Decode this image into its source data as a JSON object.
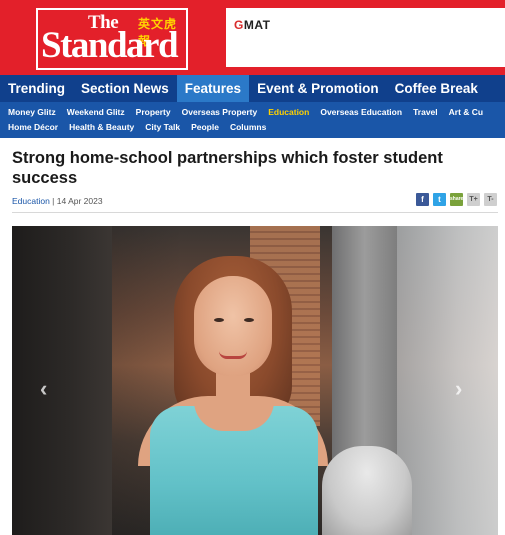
{
  "brand": {
    "logo_the": "The",
    "logo_chinese": "英文虎報",
    "logo_name": "Standard",
    "accent_red": "#e3202a",
    "nav_blue": "#10408c"
  },
  "ad": {
    "brand_g": "G",
    "brand_rest": "MAT"
  },
  "primary_nav": {
    "items": [
      "Trending",
      "Section News",
      "Features",
      "Event & Promotion",
      "Coffee Break"
    ],
    "active": "Features"
  },
  "secondary_nav": {
    "row1": [
      "Money Glitz",
      "Weekend Glitz",
      "Property",
      "Overseas Property",
      "Education",
      "Overseas Education",
      "Travel",
      "Art & Cu"
    ],
    "row2": [
      "Home Décor",
      "Health & Beauty",
      "City Talk",
      "People",
      "Columns"
    ],
    "active": "Education"
  },
  "article": {
    "headline": "Strong home-school partnerships which foster student success",
    "category": "Education",
    "separator": " | ",
    "date": "14 Apr 2023"
  },
  "share": {
    "facebook": "f",
    "twitter": "t",
    "other": "share",
    "text_plus": "T+",
    "text_minus": "T-"
  },
  "carousel": {
    "prev_icon": "‹",
    "next_icon": "›"
  }
}
